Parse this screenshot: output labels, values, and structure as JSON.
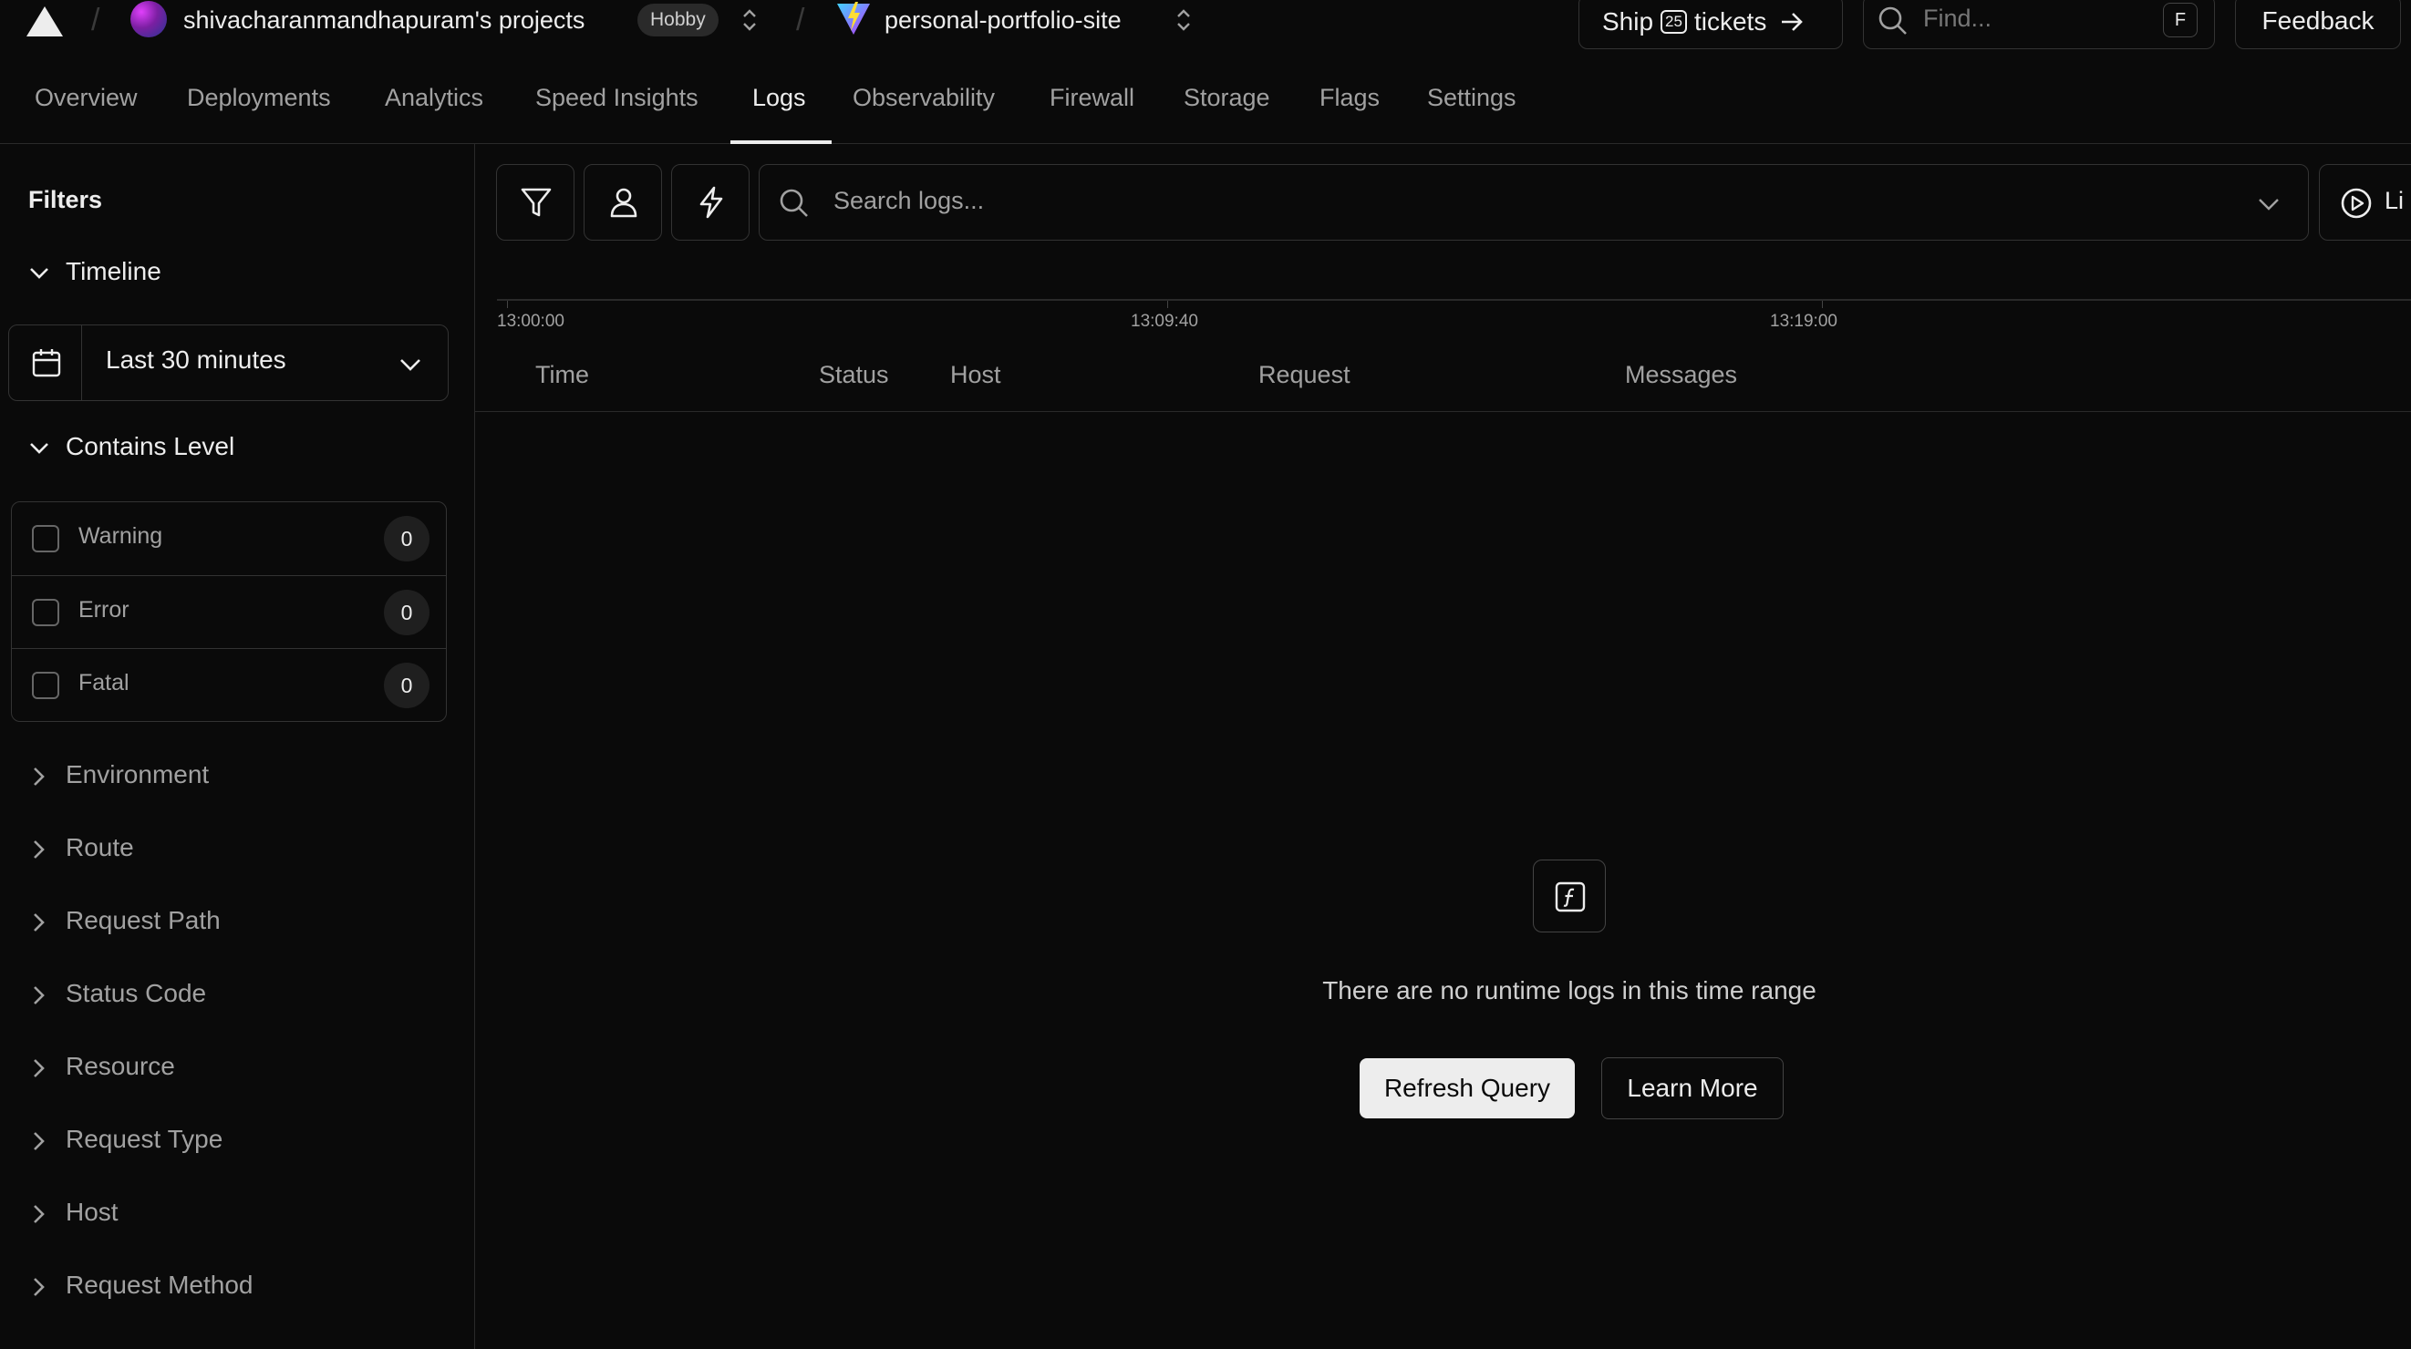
{
  "colors": {
    "background": "#0a0a0a",
    "border": "#2a2a2a",
    "text": "#ededed",
    "muted": "#a1a1a1",
    "primary_button": "#ededed"
  },
  "header": {
    "team_name": "shivacharanmandhapuram's projects",
    "plan_badge": "Hobby",
    "project_name": "personal-portfolio-site",
    "ship": {
      "label_before": "Ship",
      "badge": "25",
      "label_after": "tickets"
    },
    "find": {
      "placeholder": "Find...",
      "shortcut": "F"
    },
    "feedback_label": "Feedback",
    "icons": [
      "vercel-logo-icon",
      "team-avatar",
      "chevron-up-down-icon",
      "vite-logo-icon",
      "arrow-right-icon",
      "search-icon"
    ]
  },
  "nav": {
    "tabs": [
      {
        "label": "Overview"
      },
      {
        "label": "Deployments"
      },
      {
        "label": "Analytics"
      },
      {
        "label": "Speed Insights"
      },
      {
        "label": "Logs",
        "active": true
      },
      {
        "label": "Observability"
      },
      {
        "label": "Firewall"
      },
      {
        "label": "Storage"
      },
      {
        "label": "Flags"
      },
      {
        "label": "Settings"
      }
    ]
  },
  "sidebar": {
    "title": "Filters",
    "timeline": {
      "label": "Timeline",
      "value": "Last 30 minutes"
    },
    "contains_level": {
      "label": "Contains Level",
      "items": [
        {
          "label": "Warning",
          "count": "0"
        },
        {
          "label": "Error",
          "count": "0"
        },
        {
          "label": "Fatal",
          "count": "0"
        }
      ]
    },
    "collapsed_sections": [
      "Environment",
      "Route",
      "Request Path",
      "Status Code",
      "Resource",
      "Request Type",
      "Host",
      "Request Method"
    ]
  },
  "main": {
    "search_placeholder": "Search logs...",
    "live_label": "Li",
    "timeline_ticks": [
      "13:00:00",
      "13:09:40",
      "13:19:00"
    ],
    "columns": [
      "Time",
      "Status",
      "Host",
      "Request",
      "Messages"
    ],
    "empty_message": "There are no runtime logs in this time range",
    "refresh_label": "Refresh Query",
    "learn_more_label": "Learn More"
  }
}
